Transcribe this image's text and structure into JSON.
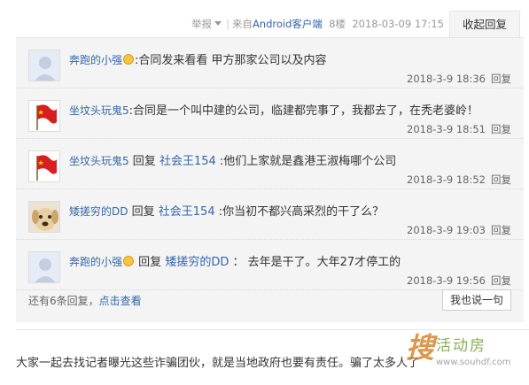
{
  "meta": {
    "report_label": "举报",
    "separator": "|",
    "from_label": "来自",
    "app_label": "Android客户端",
    "floor": "8楼",
    "timestamp": "2018-03-09 17:15",
    "collapse_label": "收起回复"
  },
  "replies": [
    {
      "username": "奔跑的小强",
      "has_emoji": true,
      "reply_word": "",
      "target": "",
      "content": ":合同发来看看 甲方那家公司以及内容",
      "time": "2018-3-9 18:36",
      "reply_label": "回复",
      "avatar": "default-avatar"
    },
    {
      "username": "坐坟头玩鬼5",
      "has_emoji": false,
      "reply_word": "",
      "target": "",
      "content": ":合同是一个叫中建的公司，临建都完事了，我都去了，在秃老婆岭！",
      "time": "2018-3-9 18:51",
      "reply_label": "回复",
      "avatar": "flag-avatar"
    },
    {
      "username": "坐坟头玩鬼5",
      "has_emoji": false,
      "reply_word": "回复",
      "target": "社会王154",
      "content": ":他们上家就是鑫港王淑梅哪个公司",
      "time": "2018-3-9 18:52",
      "reply_label": "回复",
      "avatar": "flag-avatar"
    },
    {
      "username": "矮搓穷的DD",
      "has_emoji": false,
      "reply_word": "回复",
      "target": "社会王154",
      "content": ":你当初不都兴高采烈的干了么？",
      "time": "2018-3-9 19:03",
      "reply_label": "回复",
      "avatar": "dog-avatar"
    },
    {
      "username": "奔跑的小强",
      "has_emoji": true,
      "reply_word": "回复",
      "target": "矮搓穷的DD",
      "content": "： 去年是干了。大年27才停工的",
      "time": "2018-3-9 19:56",
      "reply_label": "回复",
      "avatar": "default-avatar"
    }
  ],
  "footer": {
    "more_text": "还有6条回复，",
    "view_link": "点击查看",
    "say_button": "我也说一句"
  },
  "post": {
    "text": "大家一起去找记者曝光这些诈骗团伙，就是当地政府也要有责任。骗了太多人了"
  },
  "watermark": {
    "char": "搜",
    "name": "活动房",
    "url": "www.souhdf.com"
  },
  "colors": {
    "link": "#3366aa",
    "panel_bg": "#f4f4f4",
    "meta_gray": "#999999"
  }
}
